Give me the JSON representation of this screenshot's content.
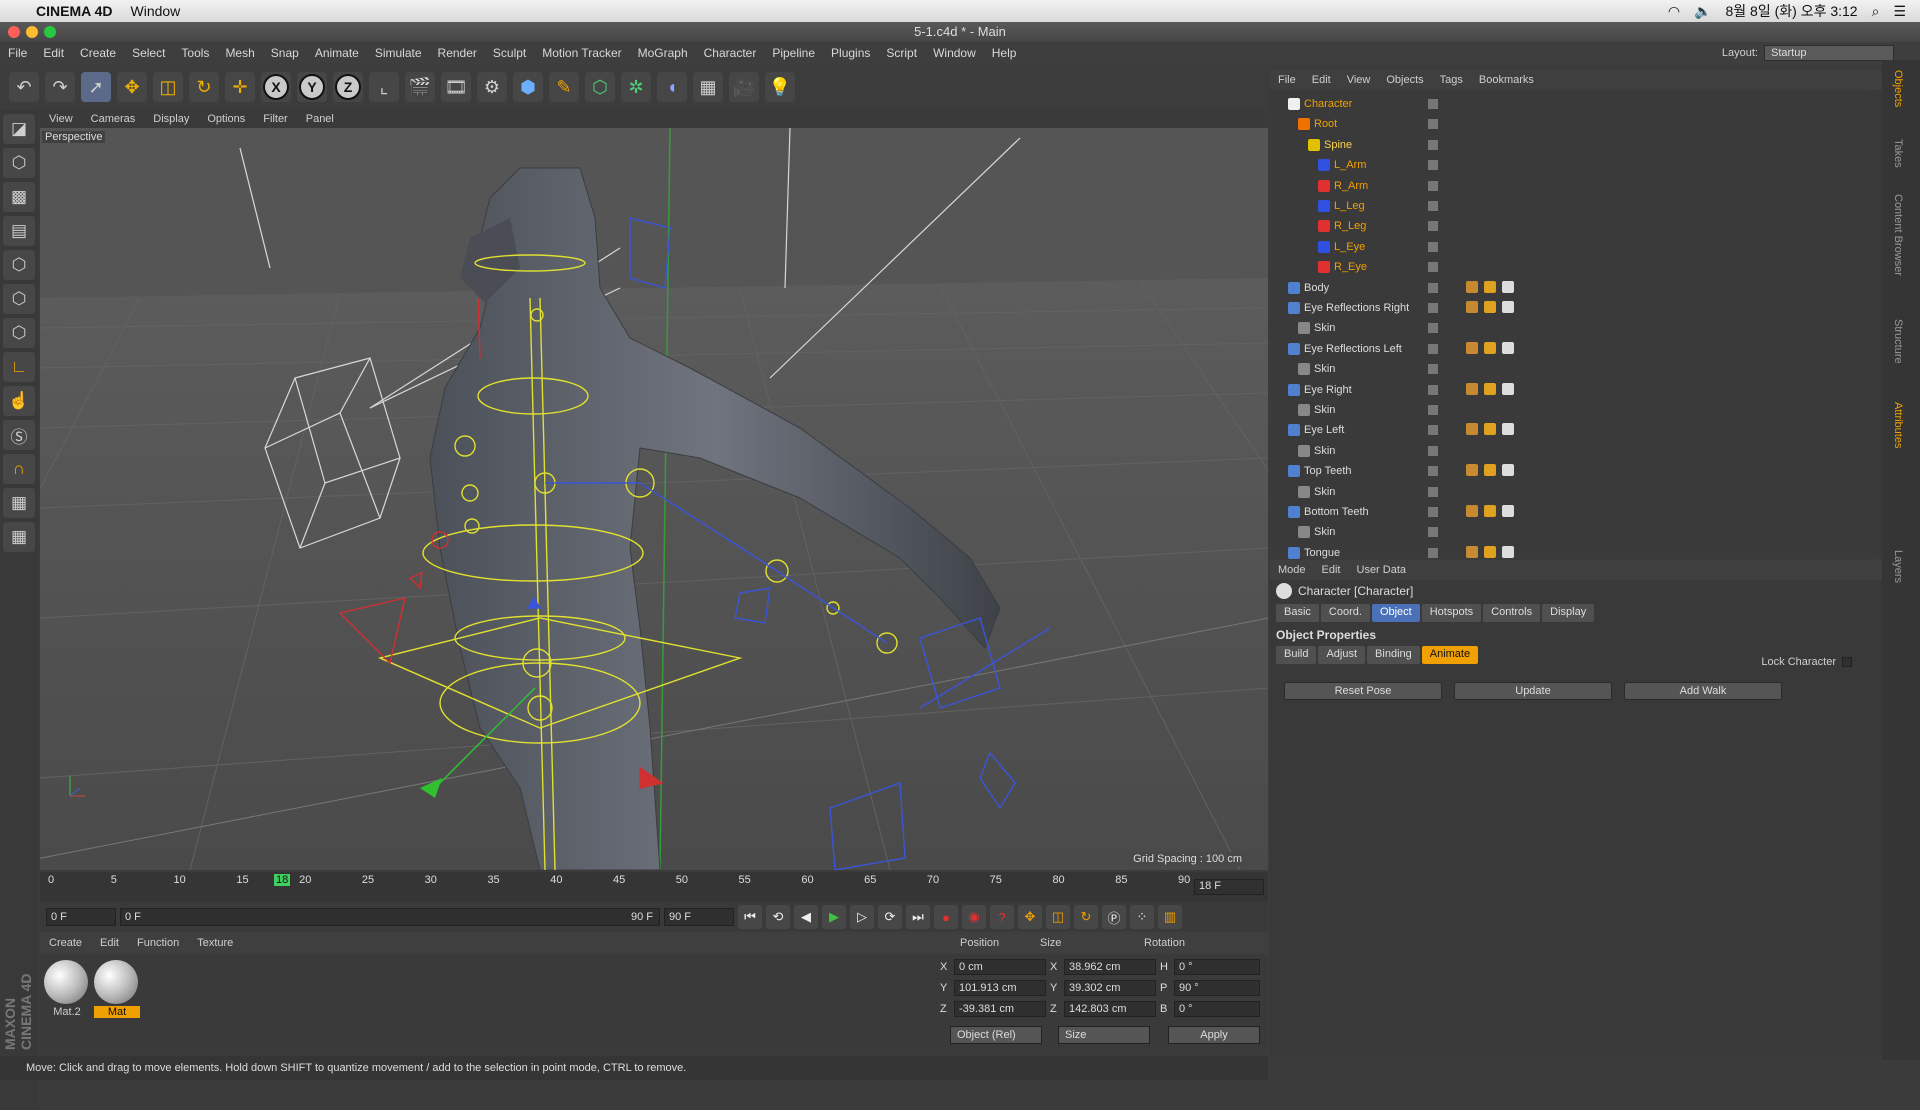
{
  "mac": {
    "app": "CINEMA 4D",
    "window_menu": "Window",
    "clock": "8월 8일 (화) 오후 3:12"
  },
  "window": {
    "title": "5-1.c4d * - Main"
  },
  "menu": [
    "File",
    "Edit",
    "Create",
    "Select",
    "Tools",
    "Mesh",
    "Snap",
    "Animate",
    "Simulate",
    "Render",
    "Sculpt",
    "Motion Tracker",
    "MoGraph",
    "Character",
    "Pipeline",
    "Plugins",
    "Script",
    "Window",
    "Help"
  ],
  "layout": {
    "label": "Layout:",
    "value": "Startup"
  },
  "viewport": {
    "menu": [
      "View",
      "Cameras",
      "Display",
      "Options",
      "Filter",
      "Panel"
    ],
    "camera_label": "Perspective",
    "grid_spacing": "Grid Spacing : 100 cm"
  },
  "timeline": {
    "ticks": [
      "0",
      "5",
      "10",
      "15",
      "20",
      "25",
      "30",
      "35",
      "40",
      "45",
      "50",
      "55",
      "60",
      "65",
      "70",
      "75",
      "80",
      "85",
      "90"
    ],
    "current": "18",
    "frame_field": "18 F"
  },
  "transport": {
    "start": "0 F",
    "range_start": "0 F",
    "range_end": "90 F",
    "end": "90 F"
  },
  "materials": {
    "menu": [
      "Create",
      "Edit",
      "Function",
      "Texture"
    ],
    "items": [
      "Mat.2",
      "Mat"
    ]
  },
  "coords": {
    "headers": [
      "Position",
      "Size",
      "Rotation"
    ],
    "rows": [
      {
        "axis": "X",
        "pos": "0 cm",
        "size_axis": "X",
        "size": "38.962 cm",
        "rot_axis": "H",
        "rot": "0 °"
      },
      {
        "axis": "Y",
        "pos": "101.913 cm",
        "size_axis": "Y",
        "size": "39.302 cm",
        "rot_axis": "P",
        "rot": "90 °"
      },
      {
        "axis": "Z",
        "pos": "-39.381 cm",
        "size_axis": "Z",
        "size": "142.803 cm",
        "rot_axis": "B",
        "rot": "0 °"
      }
    ],
    "mode": "Object (Rel)",
    "size_mode": "Size",
    "apply": "Apply"
  },
  "status": "Move: Click and drag to move elements. Hold down SHIFT to quantize movement / add to the selection in point mode, CTRL to remove.",
  "maxon": "MAXON CINEMA 4D",
  "objects": {
    "menu": [
      "File",
      "Edit",
      "View",
      "Objects",
      "Tags",
      "Bookmarks"
    ],
    "rows": [
      {
        "name": "Character",
        "indent": 0,
        "style": "hl"
      },
      {
        "name": "Root",
        "indent": 1,
        "style": "hl"
      },
      {
        "name": "Spine",
        "indent": 2,
        "style": "sel"
      },
      {
        "name": "L_Arm",
        "indent": 3,
        "style": "hl"
      },
      {
        "name": "R_Arm",
        "indent": 3,
        "style": "hl"
      },
      {
        "name": "L_Leg",
        "indent": 3,
        "style": "hl"
      },
      {
        "name": "R_Leg",
        "indent": 3,
        "style": "hl"
      },
      {
        "name": "L_Eye",
        "indent": 3,
        "style": "hl"
      },
      {
        "name": "R_Eye",
        "indent": 3,
        "style": "hl"
      },
      {
        "name": "Body",
        "indent": 0,
        "style": ""
      },
      {
        "name": "Eye Reflections Right",
        "indent": 0,
        "style": ""
      },
      {
        "name": "Skin",
        "indent": 1,
        "style": ""
      },
      {
        "name": "Eye Reflections Left",
        "indent": 0,
        "style": ""
      },
      {
        "name": "Skin",
        "indent": 1,
        "style": ""
      },
      {
        "name": "Eye Right",
        "indent": 0,
        "style": ""
      },
      {
        "name": "Skin",
        "indent": 1,
        "style": ""
      },
      {
        "name": "Eye Left",
        "indent": 0,
        "style": ""
      },
      {
        "name": "Skin",
        "indent": 1,
        "style": ""
      },
      {
        "name": "Top Teeth",
        "indent": 0,
        "style": ""
      },
      {
        "name": "Skin",
        "indent": 1,
        "style": ""
      },
      {
        "name": "Bottom Teeth",
        "indent": 0,
        "style": ""
      },
      {
        "name": "Skin",
        "indent": 1,
        "style": ""
      },
      {
        "name": "Tongue",
        "indent": 0,
        "style": ""
      }
    ]
  },
  "attributes": {
    "menu": [
      "Mode",
      "Edit",
      "User Data"
    ],
    "title": "Character [Character]",
    "tabs": [
      "Basic",
      "Coord.",
      "Object",
      "Hotspots",
      "Controls",
      "Display"
    ],
    "active_tab": "Object",
    "section": "Object Properties",
    "subtabs": [
      "Build",
      "Adjust",
      "Binding",
      "Animate"
    ],
    "active_subtab": "Animate",
    "lock_label": "Lock Character",
    "buttons": [
      "Reset Pose",
      "Update",
      "Add Walk"
    ]
  },
  "side_tabs": [
    "Objects",
    "Takes",
    "Content Browser",
    "Structure",
    "Attributes",
    "Layers"
  ]
}
